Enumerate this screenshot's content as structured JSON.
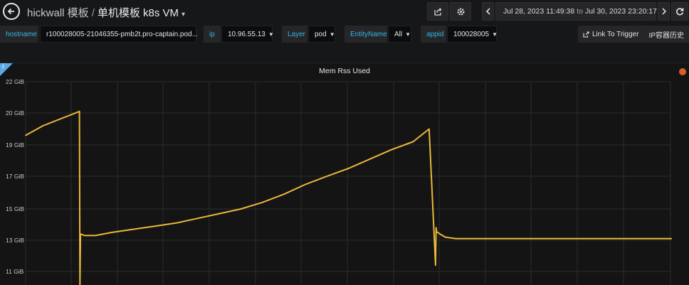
{
  "nav": {
    "folder": "hickwall 模板",
    "separator": "/",
    "dashboard_title": "单机模板 k8s VM",
    "back_icon": "arrow-left-icon"
  },
  "toolbar": {
    "share_icon": "share-icon",
    "settings_icon": "gear-icon",
    "time_from": "Jul 28, 2023 11:49:38",
    "time_to_word": "to",
    "time_to": "Jul 30, 2023 23:20:17",
    "refresh_icon": "refresh-icon"
  },
  "variables": [
    {
      "label": "hostname",
      "value": "r100028005-21046355-pmb2t.pro-captain.pod..."
    },
    {
      "label": "ip",
      "value": "10.96.55.13"
    },
    {
      "label": "Layer",
      "value": "pod"
    },
    {
      "label": "EntityName",
      "value": "All"
    },
    {
      "label": "appid",
      "value": "100028005"
    }
  ],
  "links": {
    "trigger": "Link To Trigger",
    "ip_history": "IP容器历史"
  },
  "panel": {
    "title": "Mem Rss Used",
    "info_icon": "info-icon",
    "alert_icon": "alert-heart-icon"
  },
  "chart_data": {
    "type": "line",
    "title": "Mem Rss Used",
    "ylabel": "",
    "y_unit": "GiB",
    "y_ticks": [
      "22 GiB",
      "20 GiB",
      "19 GiB",
      "17 GiB",
      "15 GiB",
      "13 GiB",
      "11 GiB"
    ],
    "y_tick_values": [
      22,
      20,
      19,
      17,
      15,
      13,
      11
    ],
    "ylim": [
      9.6,
      22
    ],
    "grid": true,
    "series": [
      {
        "color": "#eab839",
        "x": [
          0,
          1.6,
          5.0,
          5.05,
          5.1,
          5.5,
          6.5,
          8,
          10,
          12,
          14,
          16,
          18,
          20,
          22,
          24,
          26,
          28,
          30,
          32,
          34,
          36,
          37.5,
          38.1,
          38.15,
          38.2,
          38.3,
          38.5,
          39,
          40,
          42,
          45,
          50,
          55,
          60,
          59.9
        ],
        "y": [
          19.3,
          19.6,
          20.1,
          9.6,
          13.4,
          13.3,
          13.3,
          13.5,
          13.7,
          13.9,
          14.1,
          14.4,
          14.7,
          15.0,
          15.4,
          15.9,
          16.5,
          17.0,
          17.5,
          18.1,
          18.7,
          19.1,
          19.5,
          11.4,
          13.8,
          13.5,
          13.5,
          13.4,
          13.2,
          13.1,
          13.1,
          13.1,
          13.1,
          13.1,
          13.1,
          13.1
        ]
      }
    ]
  }
}
